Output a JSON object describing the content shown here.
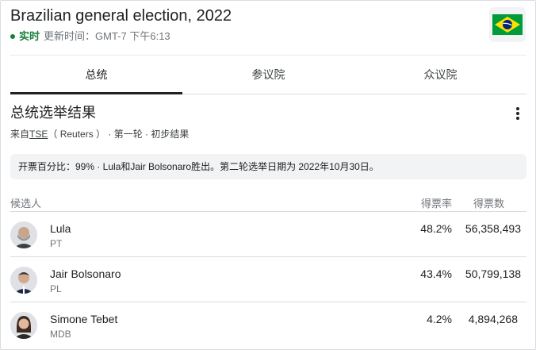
{
  "header": {
    "title": "Brazilian general election, 2022",
    "live_label": "实时",
    "updated_text": "更新时间：GMT-7 下午6:13",
    "flag_icon": "brazil-flag-icon"
  },
  "tabs": [
    {
      "label": "总统",
      "active": true
    },
    {
      "label": "参议院",
      "active": false
    },
    {
      "label": "众议院",
      "active": false
    }
  ],
  "results": {
    "title": "总统选举结果",
    "source_prefix": "来自",
    "source_link": "TSE",
    "source_suffix": "（ Reuters ） · 第一轮 · 初步结果",
    "notice": "开票百分比：99% · Lula和Jair Bolsonaro胜出。第二轮选举日期为 2022年10月30日。",
    "columns": {
      "candidate": "候选人",
      "pct": "得票率",
      "votes": "得票数"
    },
    "candidates": [
      {
        "name": "Lula",
        "party": "PT",
        "pct": "48.2%",
        "votes": "56,358,493"
      },
      {
        "name": "Jair Bolsonaro",
        "party": "PL",
        "pct": "43.4%",
        "votes": "50,799,138"
      },
      {
        "name": "Simone Tebet",
        "party": "MDB",
        "pct": "4.2%",
        "votes": "4,894,268"
      }
    ]
  },
  "colors": {
    "live": "#188038",
    "flag_green": "#009c3b",
    "flag_yellow": "#ffdf00",
    "flag_blue": "#002776"
  }
}
